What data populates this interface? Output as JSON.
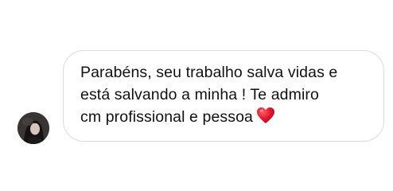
{
  "message": {
    "lines": [
      "Parabéns, seu trabalho salva vidas e",
      "está salvando a minha ! Te admiro",
      "cm profissional e pessoa"
    ],
    "emoji": "heart-icon"
  },
  "colors": {
    "bubble_border": "#dbdbdb",
    "text": "#111111",
    "heart": "#e0142b"
  }
}
